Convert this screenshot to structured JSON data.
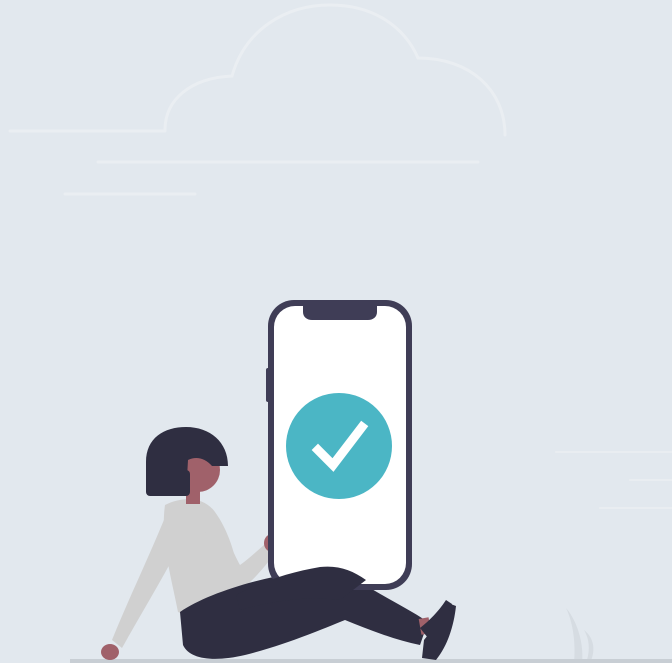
{
  "illustration": {
    "colors": {
      "background": "#e2e8ee",
      "cloud_stroke": "#eaeef2",
      "phone_frame": "#3f3d56",
      "phone_screen": "#ffffff",
      "check_circle": "#4bb6c5",
      "check_mark": "#ffffff",
      "hair": "#2f2e41",
      "skin": "#a0616a",
      "sweater": "#d0d0d0",
      "pants": "#2f2e41",
      "shoes": "#2f2e41",
      "ground": "#c8ced4"
    },
    "icons": [
      "cloud-icon",
      "check-circle-icon",
      "smartphone-icon"
    ]
  }
}
